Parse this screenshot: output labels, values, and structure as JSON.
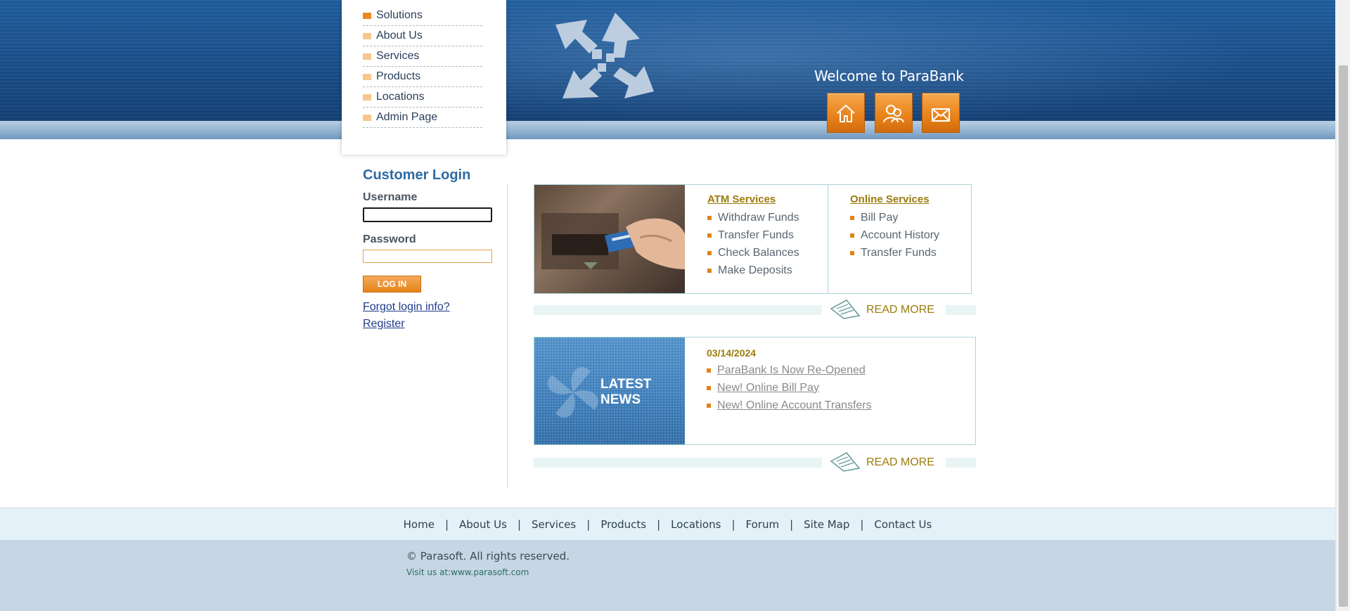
{
  "header": {
    "welcome": "Welcome to ParaBank",
    "logo_icon": "parabank-logo-icon",
    "buttons": [
      {
        "icon": "home-icon"
      },
      {
        "icon": "about-people-icon"
      },
      {
        "icon": "contact-envelope-icon"
      }
    ]
  },
  "menu": {
    "items": [
      {
        "label": "Solutions"
      },
      {
        "label": "About Us"
      },
      {
        "label": "Services"
      },
      {
        "label": "Products"
      },
      {
        "label": "Locations"
      },
      {
        "label": "Admin Page"
      }
    ]
  },
  "login": {
    "title": "Customer Login",
    "username_label": "Username",
    "username_value": "",
    "password_label": "Password",
    "password_value": "",
    "button": "LOG IN",
    "forgot": "Forgot login info?",
    "register": "Register"
  },
  "services": {
    "atm_title": "ATM Services",
    "atm_items": [
      "Withdraw Funds",
      "Transfer Funds",
      "Check Balances",
      "Make Deposits"
    ],
    "online_title": "Online Services",
    "online_items": [
      "Bill Pay",
      "Account History",
      "Transfer Funds"
    ],
    "read_more": "READ MORE"
  },
  "news": {
    "image_title_line1": "LATEST",
    "image_title_line2": "NEWS",
    "date": "03/14/2024",
    "items": [
      "ParaBank Is Now Re-Opened",
      "New! Online Bill Pay",
      "New! Online Account Transfers"
    ],
    "read_more": "READ MORE"
  },
  "footer": {
    "nav": [
      "Home",
      "About Us",
      "Services",
      "Products",
      "Locations",
      "Forum",
      "Site Map",
      "Contact Us"
    ],
    "separator": "|",
    "copyright": "© Parasoft. All rights reserved.",
    "visit_prefix": "Visit us at:",
    "visit_link": "www.parasoft.com"
  },
  "colors": {
    "accent_orange": "#e8821a",
    "brand_blue": "#1a4f8a",
    "gold_link": "#9b7b0a"
  }
}
